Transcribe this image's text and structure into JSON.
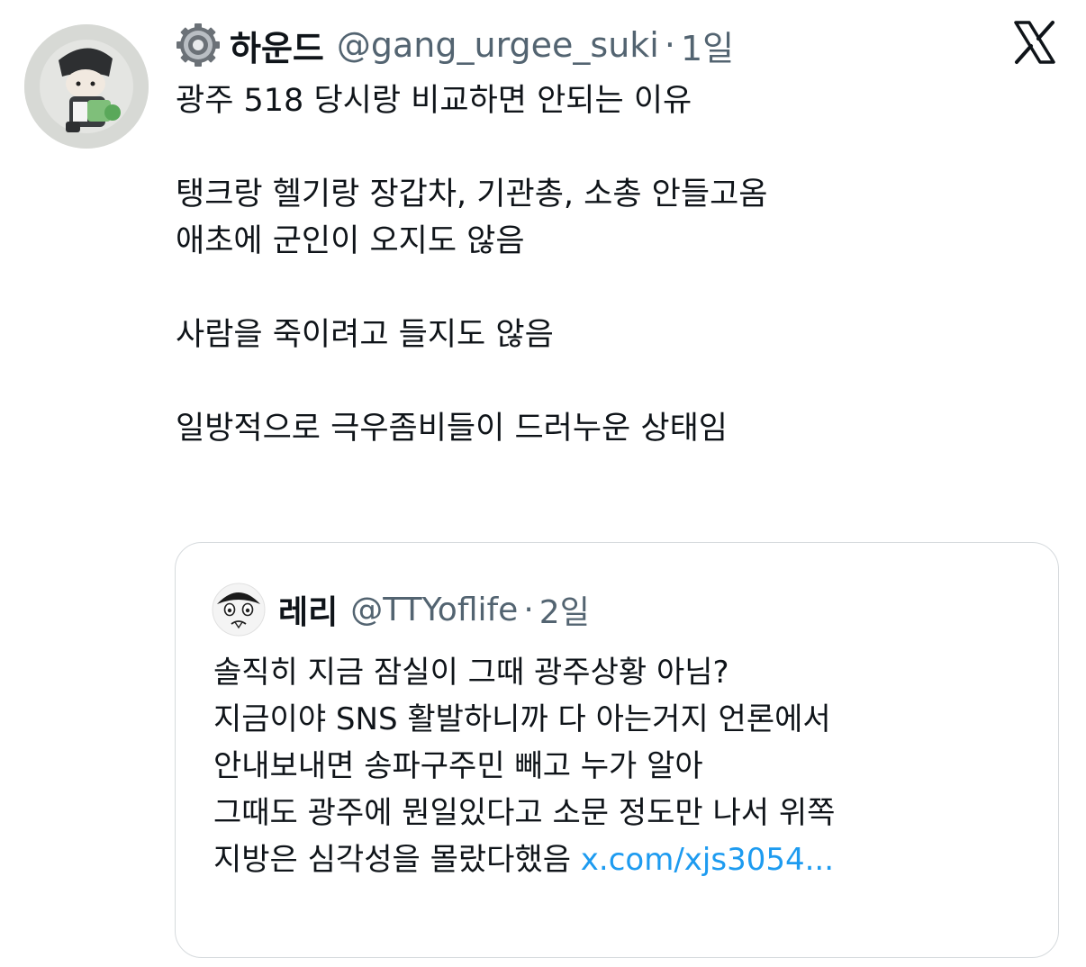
{
  "tweet": {
    "display_name": "하운드",
    "handle": "@gang_urgee_suki",
    "separator": "·",
    "time": "1일",
    "text": "광주 518 당시랑 비교하면 안되는 이유\n\n탱크랑 헬기랑 장갑차, 기관총, 소총 안들고옴\n애초에 군인이 오지도 않음\n\n사람을 죽이려고 들지도 않음\n\n일방적으로 극우좀비들이 드러누운 상태임"
  },
  "quote": {
    "display_name": "레리",
    "handle": "@TTYoflife",
    "separator": "·",
    "time": "2일",
    "text": "솔직히 지금 잠실이 그때 광주상황 아님?\n지금이야 SNS 활발하니까 다 아는거지 언론에서\n안내보내면 송파구주민 빼고 누가 알아\n그때도 광주에 뭔일있다고 소문 정도만 나서 위쪽\n지방은 심각성을 몰랐다했음 ",
    "link": "x.com/xjs3054..."
  },
  "icons": {
    "gear": "gear-icon",
    "platform": "x-logo-icon"
  },
  "colors": {
    "text": "#0f1419",
    "muted": "#536471",
    "link": "#1d9bf0",
    "border": "#d6dadd"
  }
}
